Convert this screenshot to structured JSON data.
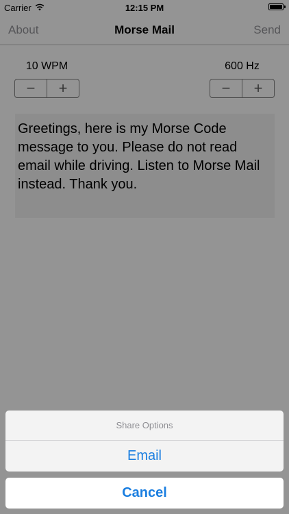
{
  "status_bar": {
    "carrier": "Carrier",
    "time": "12:15 PM",
    "battery_level": 1.0
  },
  "nav": {
    "left_label": "About",
    "title": "Morse Mail",
    "right_label": "Send"
  },
  "wpm": {
    "label": "10 WPM",
    "minus": "−",
    "plus": "+"
  },
  "freq": {
    "label": "600 Hz",
    "minus": "−",
    "plus": "+"
  },
  "message": {
    "text": "Greetings, here is my Morse Code message to you. Please do not read email while driving. Listen to Morse Mail instead. Thank you."
  },
  "action_sheet": {
    "title": "Share Options",
    "options": [
      {
        "label": "Email"
      }
    ],
    "cancel_label": "Cancel"
  },
  "colors": {
    "accent": "#1a7ee0",
    "nav_button": "#8e8e93"
  },
  "icons": {
    "signal": "wifi-icon",
    "battery": "battery-icon"
  }
}
